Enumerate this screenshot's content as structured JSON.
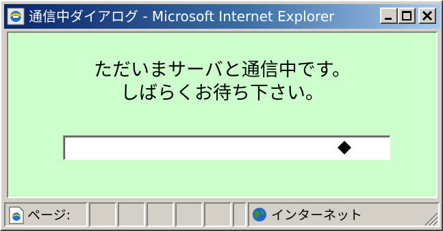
{
  "window": {
    "title": "通信中ダイアログ - Microsoft Internet Explorer"
  },
  "message": {
    "line1": "ただいまサーバと通信中です。",
    "line2": "しばらくお待ち下さい。"
  },
  "progress": {
    "marker_position": 0.86,
    "marker_icon": "diamond-icon"
  },
  "statusbar": {
    "page_label": "ページ:",
    "zone_label": "インターネット",
    "page_icon": "ie-page-icon",
    "zone_icon": "globe-icon"
  },
  "colors": {
    "title_gradient_start": "#0a246a",
    "title_gradient_end": "#a6caf0",
    "content_background": "#ccffcc",
    "chrome": "#d4d0c8"
  }
}
